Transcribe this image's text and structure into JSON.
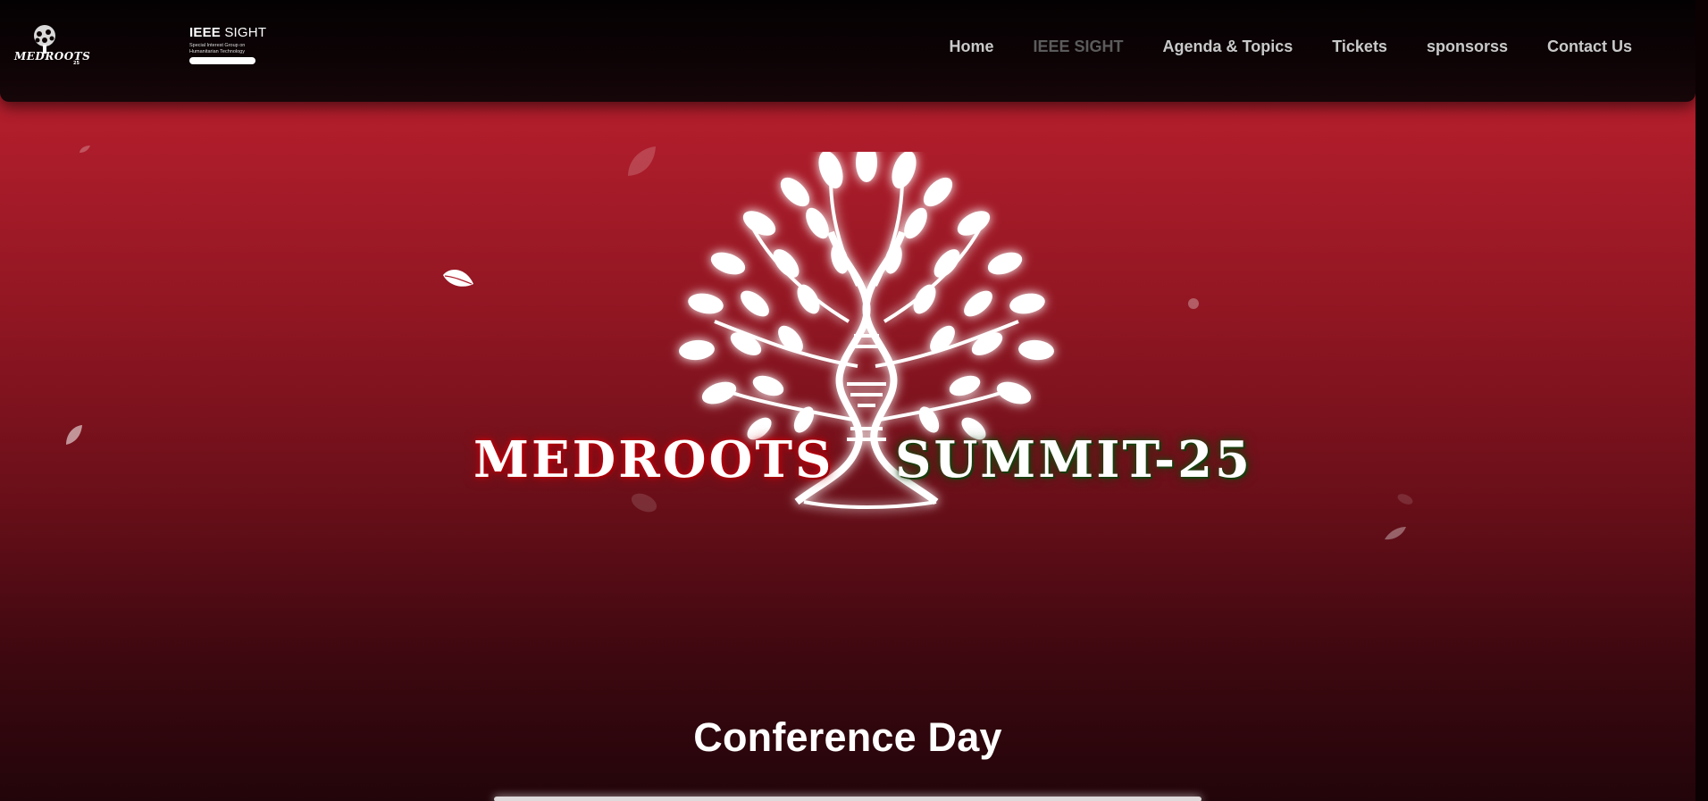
{
  "header": {
    "logo_text": "MEDROOTS",
    "logo_year": "25",
    "partner_logo": {
      "title_bold": "IEEE",
      "title_light": " SIGHT",
      "subtitle_line1": "Special Interest Group on",
      "subtitle_line2": "Humanitarian Technology"
    },
    "nav": [
      {
        "label": "Home",
        "active": false
      },
      {
        "label": "IEEE SIGHT",
        "active": true
      },
      {
        "label": "Agenda & Topics",
        "active": false
      },
      {
        "label": "Tickets",
        "active": false
      },
      {
        "label": "sponsorss",
        "active": false
      },
      {
        "label": "Contact Us",
        "active": false
      }
    ]
  },
  "hero": {
    "title_left": "MEDROOTS",
    "title_right": "SUMMIT-25",
    "icon": "tree-dna-icon"
  },
  "section": {
    "title": "Conference Day"
  },
  "colors": {
    "background_top": "#b8202e",
    "background_bottom": "#22050a",
    "nav_text": "#c9c9c9",
    "nav_active": "#5b5b5b",
    "title_glow_red": "#d9000d",
    "title_glow_green": "#1d4a12"
  }
}
